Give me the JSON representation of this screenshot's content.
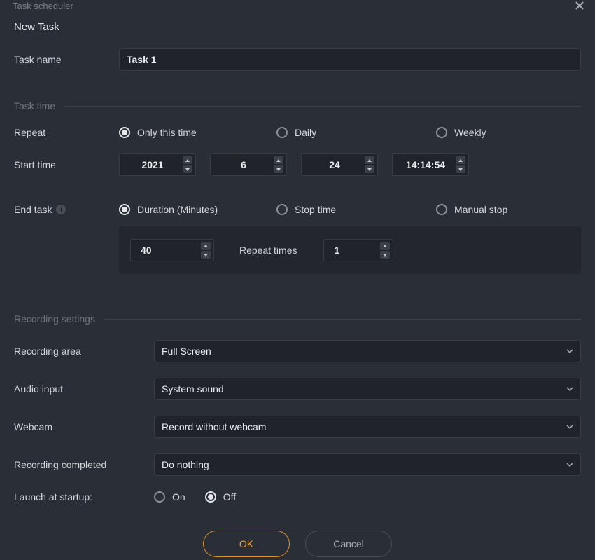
{
  "window": {
    "title": "Task scheduler"
  },
  "subtitle": "New Task",
  "task_name": {
    "label": "Task name",
    "value": "Task 1"
  },
  "sections": {
    "task_time": "Task time",
    "recording": "Recording settings"
  },
  "repeat": {
    "label": "Repeat",
    "options": [
      "Only this time",
      "Daily",
      "Weekly"
    ],
    "selected": 0
  },
  "start_time": {
    "label": "Start time",
    "year": "2021",
    "month": "6",
    "day": "24",
    "time": "14:14:54"
  },
  "end_task": {
    "label": "End task",
    "options": [
      "Duration (Minutes)",
      "Stop time",
      "Manual stop"
    ],
    "selected": 0,
    "duration": "40",
    "repeat_times_label": "Repeat times",
    "repeat_times": "1"
  },
  "recording_area": {
    "label": "Recording area",
    "value": "Full Screen"
  },
  "audio_input": {
    "label": "Audio input",
    "value": "System sound"
  },
  "webcam": {
    "label": "Webcam",
    "value": "Record without webcam"
  },
  "recording_completed": {
    "label": "Recording completed",
    "value": "Do nothing"
  },
  "launch_at_startup": {
    "label": "Launch at startup:",
    "options": [
      "On",
      "Off"
    ],
    "selected": 1
  },
  "buttons": {
    "ok": "OK",
    "cancel": "Cancel"
  }
}
